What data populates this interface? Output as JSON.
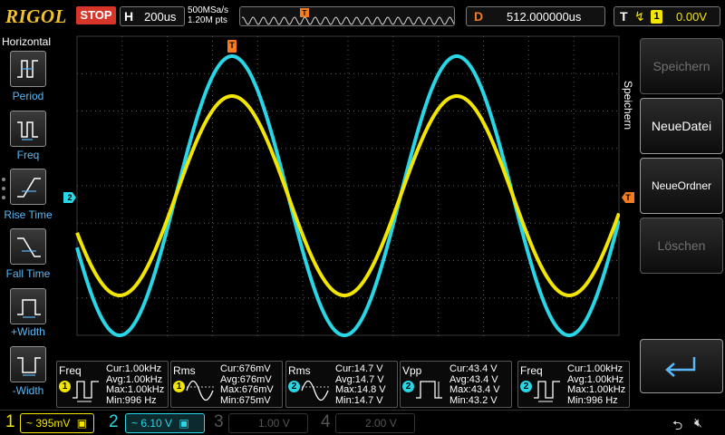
{
  "brand": "RIGOL",
  "run_state": "STOP",
  "horizontal": {
    "key": "H",
    "timebase": "200us",
    "sample_rate": "500MSa/s",
    "mem_depth": "1.20M pts"
  },
  "delay": {
    "key": "D",
    "value": "512.000000us"
  },
  "trigger": {
    "key": "T",
    "source": "1",
    "level": "0.00V",
    "marker": "T"
  },
  "left_menu": {
    "title": "Horizontal",
    "items": [
      {
        "label": "Period"
      },
      {
        "label": "Freq"
      },
      {
        "label": "Rise Time"
      },
      {
        "label": "Fall Time"
      },
      {
        "label": "+Width"
      },
      {
        "label": "-Width"
      }
    ]
  },
  "right_menu": {
    "title": "Speichern",
    "items": [
      {
        "label": "Speichern",
        "enabled": false
      },
      {
        "label": "NeueDatei",
        "enabled": true
      },
      {
        "label": "NeueOrdner",
        "enabled": true
      },
      {
        "label": "Löschen",
        "enabled": false
      },
      {
        "label": "enter-icon",
        "enabled": true
      }
    ]
  },
  "ch2_marker": "2",
  "measurements": [
    {
      "name": "Freq",
      "ch": "1",
      "icon": "pulse-period-icon",
      "cur": "Cur:1.00kHz",
      "avg": "Avg:1.00kHz",
      "max": "Max:1.00kHz",
      "min": "Min:996 Hz"
    },
    {
      "name": "Rms",
      "ch": "1",
      "icon": "sine-rms-icon",
      "cur": "Cur:676mV",
      "avg": "Avg:676mV",
      "max": "Max:676mV",
      "min": "Min:675mV"
    },
    {
      "name": "Rms",
      "ch": "2",
      "icon": "sine-rms-icon",
      "cur": "Cur:14.7 V",
      "avg": "Avg:14.7 V",
      "max": "Max:14.8 V",
      "min": "Min:14.7 V"
    },
    {
      "name": "Vpp",
      "ch": "2",
      "icon": "pulse-vpp-icon",
      "cur": "Cur:43.4 V",
      "avg": "Avg:43.4 V",
      "max": "Max:43.4 V",
      "min": "Min:43.2 V"
    },
    {
      "name": "Freq",
      "ch": "2",
      "icon": "pulse-period-icon",
      "cur": "Cur:1.00kHz",
      "avg": "Avg:1.00kHz",
      "max": "Max:1.00kHz",
      "min": "Min:996 Hz"
    }
  ],
  "channels": [
    {
      "num": "1",
      "coupling": "~",
      "scale": "395mV",
      "color": "#f2e500",
      "active": true
    },
    {
      "num": "2",
      "coupling": "~",
      "scale": "6.10 V",
      "color": "#29d6e6",
      "active": true
    },
    {
      "num": "3",
      "coupling": "",
      "scale": "1.00 V",
      "color": "#555555",
      "active": false
    },
    {
      "num": "4",
      "coupling": "",
      "scale": "2.00 V",
      "color": "#555555",
      "active": false
    }
  ],
  "colors": {
    "ch1": "#f2e500",
    "ch2": "#29d6e6",
    "trigger": "#f57c1e",
    "accent": "#5ab8f5",
    "stop": "#d8352a"
  }
}
